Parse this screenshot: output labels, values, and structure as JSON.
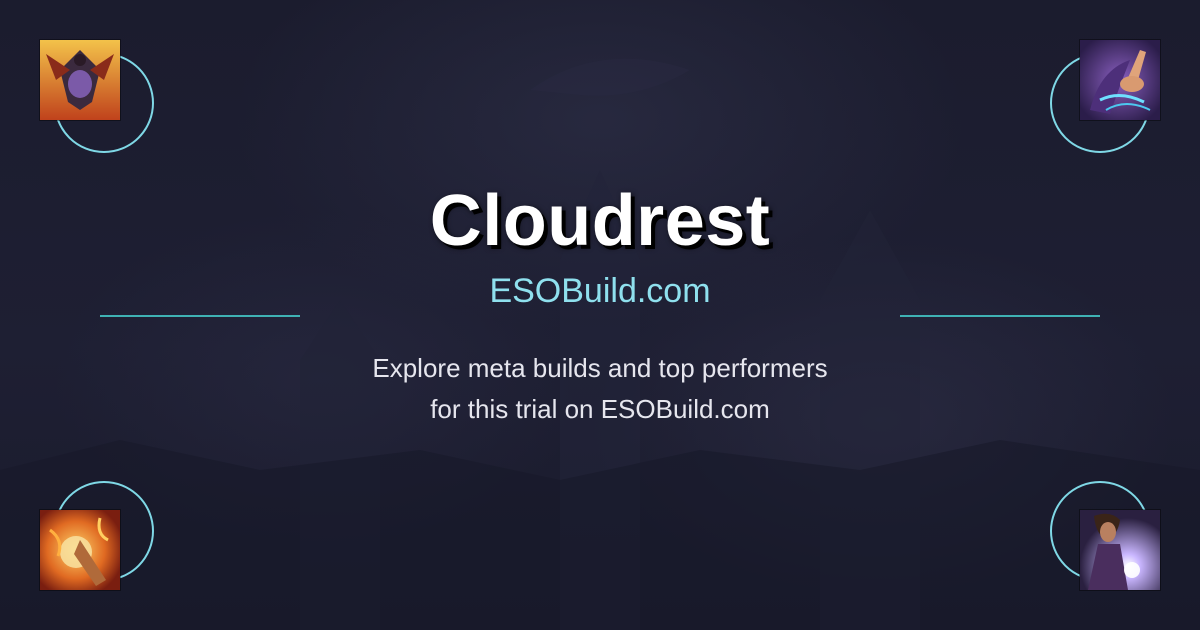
{
  "title": "Cloudrest",
  "site": "ESOBuild.com",
  "description": {
    "line1": "Explore meta builds and top performers",
    "line2": "for this trial on ESOBuild.com"
  },
  "colors": {
    "background": "#1c1d30",
    "accent": "#8fe0ee",
    "divider": "#3fb2b4",
    "ring": "#7fd8e6"
  },
  "icons": {
    "top_left": "fire-bird-skill-icon",
    "top_right": "magic-hand-skill-icon",
    "bottom_left": "flame-fist-skill-icon",
    "bottom_right": "sorcerer-light-skill-icon"
  }
}
